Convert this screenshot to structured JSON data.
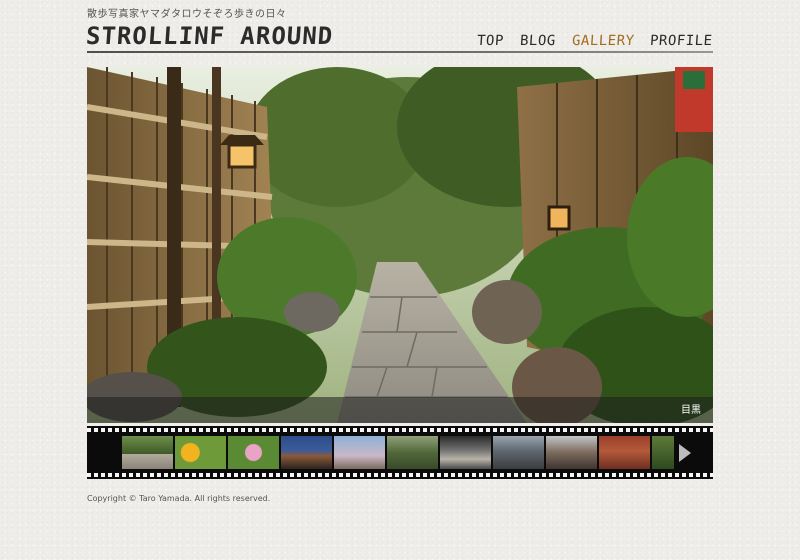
{
  "site": {
    "tagline": "散歩写真家ヤマダタロウそぞろ歩きの日々",
    "logo": "STROLLINF AROUND"
  },
  "nav": [
    {
      "label": "TOP",
      "active": false
    },
    {
      "label": "BLOG",
      "active": false
    },
    {
      "label": "GALLERY",
      "active": true
    },
    {
      "label": "PROFILE",
      "active": false
    }
  ],
  "hero": {
    "caption": "目黒"
  },
  "filmstrip": {
    "thumbnails": [
      {
        "name": "thumb-alley"
      },
      {
        "name": "thumb-sunflowers"
      },
      {
        "name": "thumb-pink-flower"
      },
      {
        "name": "thumb-night-building"
      },
      {
        "name": "thumb-blossom-tree"
      },
      {
        "name": "thumb-garden"
      },
      {
        "name": "thumb-modern-building"
      },
      {
        "name": "thumb-street"
      },
      {
        "name": "thumb-station"
      },
      {
        "name": "thumb-brick-building"
      },
      {
        "name": "thumb-partial"
      }
    ],
    "next_icon": "triangle-right-icon"
  },
  "footer": {
    "copyright": "Copyright © Taro Yamada. All rights reserved."
  }
}
